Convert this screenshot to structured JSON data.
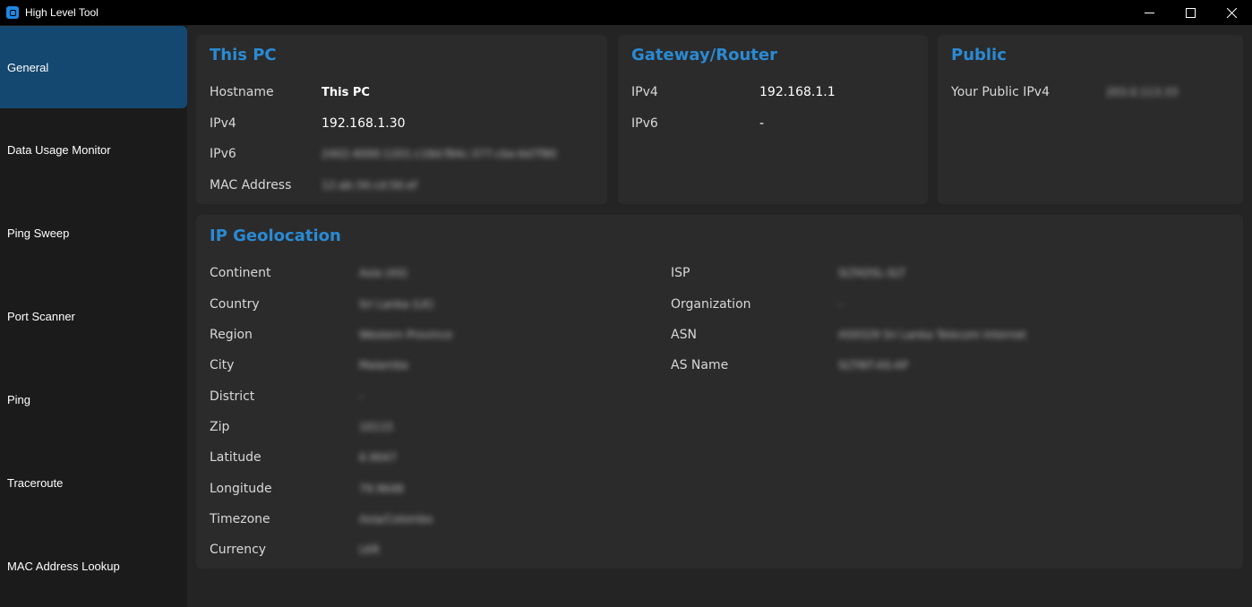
{
  "window": {
    "title": "High Level Tool"
  },
  "sidebar": {
    "items": [
      {
        "label": "General",
        "active": true
      },
      {
        "label": "Data Usage Monitor"
      },
      {
        "label": "Ping Sweep"
      },
      {
        "label": "Port Scanner"
      },
      {
        "label": "Ping"
      },
      {
        "label": "Traceroute"
      },
      {
        "label": "MAC Address Lookup"
      }
    ]
  },
  "this_pc": {
    "title": "This PC",
    "rows": [
      {
        "label": "Hostname",
        "value": "This PC"
      },
      {
        "label": "IPv4",
        "value": "192.168.1.30"
      },
      {
        "label": "IPv6",
        "value": "2402:4000:1201:c18d:f84c:377:cbe:6d7f80"
      },
      {
        "label": "MAC Address",
        "value": "12:ab:34:cd:56:ef"
      }
    ]
  },
  "gateway": {
    "title": "Gateway/Router",
    "rows": [
      {
        "label": "IPv4",
        "value": "192.168.1.1"
      },
      {
        "label": "IPv6",
        "value": "-"
      }
    ]
  },
  "public": {
    "title": "Public",
    "rows": [
      {
        "label": "Your Public IPv4",
        "value": "203.0.113.33"
      }
    ]
  },
  "geo": {
    "title": "IP Geolocation",
    "left": [
      {
        "label": "Continent",
        "value": "Asia (AS)"
      },
      {
        "label": "Country",
        "value": "Sri Lanka (LK)"
      },
      {
        "label": "Region",
        "value": "Western Province"
      },
      {
        "label": "City",
        "value": "Malambe"
      },
      {
        "label": "District",
        "value": "-"
      },
      {
        "label": "Zip",
        "value": "10115"
      },
      {
        "label": "Latitude",
        "value": "6.9047"
      },
      {
        "label": "Longitude",
        "value": "79.9648"
      },
      {
        "label": "Timezone",
        "value": "Asia/Colombo"
      },
      {
        "label": "Currency",
        "value": "LKR"
      }
    ],
    "right": [
      {
        "label": "ISP",
        "value": "SLTADSL-SLT"
      },
      {
        "label": "Organization",
        "value": "-"
      },
      {
        "label": "ASN",
        "value": "AS9329 Sri Lanka Telecom Internet"
      },
      {
        "label": "AS Name",
        "value": "SLTINT-AS-AP"
      }
    ]
  },
  "colors": {
    "accent": "#2a8ad4",
    "active_nav": "#144870",
    "card_bg": "#2b2b2b",
    "app_bg": "#242424",
    "sidebar_bg": "#1b1b1b"
  },
  "icons": {
    "app": "app-logo-icon",
    "minimize": "minimize-icon",
    "maximize": "maximize-icon",
    "close": "close-icon"
  }
}
